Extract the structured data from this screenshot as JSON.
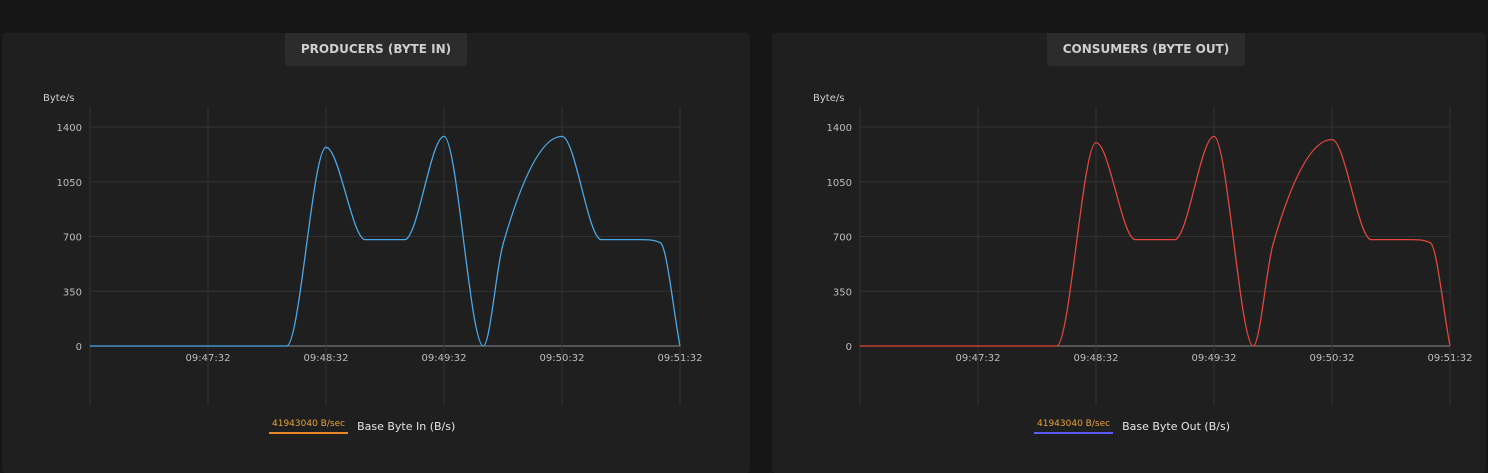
{
  "colors": {
    "producers_line": "#4aa8e8",
    "consumers_line": "#e0463c",
    "legend_text": "#e8a33a",
    "producers_legend_underline": "#e8862a",
    "consumers_legend_underline": "#5a5aff"
  },
  "panels": [
    {
      "title": "PRODUCERS (BYTE IN)",
      "legend": {
        "badge": "41943040 B/sec",
        "label": "Base Byte In (B/s)"
      }
    },
    {
      "title": "CONSUMERS (BYTE OUT)",
      "legend": {
        "badge": "41943040 B/sec",
        "label": "Base Byte Out (B/s)"
      }
    }
  ],
  "chart_data": [
    {
      "type": "line",
      "title": "PRODUCERS (BYTE IN)",
      "ylabel": "Byte/s",
      "xlabel": "",
      "ylim": [
        0,
        1400
      ],
      "yticks": [
        0,
        350,
        700,
        1050,
        1400
      ],
      "xticks": [
        "09:47:32",
        "09:48:32",
        "09:49:32",
        "09:50:32",
        "09:51:32"
      ],
      "grid": true,
      "legend_placement": "bottom-center",
      "series": [
        {
          "name": "Base Byte In (B/s)",
          "x": [
            "09:46:32",
            "09:47:02",
            "09:47:32",
            "09:48:02",
            "09:48:12",
            "09:48:32",
            "09:48:52",
            "09:49:12",
            "09:49:32",
            "09:49:52",
            "09:50:02",
            "09:50:32",
            "09:50:52",
            "09:51:12",
            "09:51:22",
            "09:51:32"
          ],
          "values": [
            0,
            0,
            0,
            0,
            0,
            1270,
            680,
            680,
            1340,
            0,
            650,
            1340,
            680,
            680,
            660,
            0
          ]
        }
      ]
    },
    {
      "type": "line",
      "title": "CONSUMERS (BYTE OUT)",
      "ylabel": "Byte/s",
      "xlabel": "",
      "ylim": [
        0,
        1400
      ],
      "yticks": [
        0,
        350,
        700,
        1050,
        1400
      ],
      "xticks": [
        "09:47:32",
        "09:48:32",
        "09:49:32",
        "09:50:32",
        "09:51:32"
      ],
      "grid": true,
      "legend_placement": "bottom-center",
      "series": [
        {
          "name": "Base Byte Out (B/s)",
          "x": [
            "09:46:32",
            "09:47:02",
            "09:47:32",
            "09:48:02",
            "09:48:12",
            "09:48:32",
            "09:48:52",
            "09:49:12",
            "09:49:32",
            "09:49:52",
            "09:50:02",
            "09:50:32",
            "09:50:52",
            "09:51:12",
            "09:51:22",
            "09:51:32"
          ],
          "values": [
            0,
            0,
            0,
            0,
            0,
            1300,
            680,
            680,
            1340,
            0,
            650,
            1320,
            680,
            680,
            660,
            0
          ]
        }
      ]
    }
  ]
}
